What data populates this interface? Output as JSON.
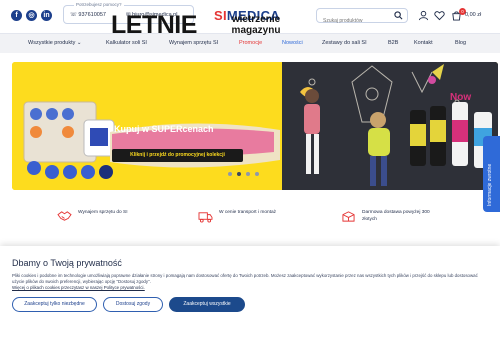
{
  "header": {
    "social_icons": [
      "facebook-icon",
      "instagram-icon",
      "linkedin-icon"
    ],
    "help_label": "Potrzebujesz pomocy?",
    "phone": "937610057",
    "email": "biuro@simedica.pl",
    "logo_prefix": "SI",
    "logo_text": "MEDICA",
    "search_placeholder": "Szukaj produktów",
    "cart_count": "0",
    "cart_total": "0,00 zł"
  },
  "nav": {
    "items": [
      "Wszystkie produkty",
      "Kalkulator soli SI",
      "Wynajem sprzętu SI",
      "Promocje",
      "Nowości",
      "Zestawy do sali SI",
      "B2B",
      "Kontakt",
      "Blog"
    ]
  },
  "banner": {
    "headline": "LETNIE",
    "subheadline": "wietrzenie magazynu",
    "promo": "Kupuj w SUPERcenach",
    "cta": "Kliknij i przejdź do promocyjnej kolekcji",
    "dots_count": 4,
    "active_dot": 1
  },
  "side_tab": {
    "label": "Informacje zwrotne"
  },
  "features": [
    {
      "icon": "handshake-icon",
      "text": "Wynajem sprzętu do SI"
    },
    {
      "icon": "truck-icon",
      "text": "W cenie transport i montaż"
    },
    {
      "icon": "package-icon",
      "text": "Darmowa dostawa powyżej 300 złotych"
    }
  ],
  "cookie": {
    "title": "Dbamy o Twoją prywatność",
    "text": "Pliki cookies i podobne im technologie umożliwiają poprawne działanie strony i pomagają nam dostosować ofertę do Twoich potrzeb. Możesz zaakceptować wykorzystanie przez nas wszystkich tych plików i przejść do sklepu lub dostosować użycie plików do swoich preferencji, wybierając opcję \"Dostosuj zgody\".",
    "more_link": "Więcej o plikach cookies przeczytasz w naszej Polityce prywatności.",
    "btn_necessary": "Zaakceptuj tylko niezbędne",
    "btn_customize": "Dostosuj zgody",
    "btn_accept_all": "Zaakceptuj wszystkie"
  },
  "colors": {
    "brand": "#1c3f8c",
    "accent_red": "#e53535",
    "banner_yellow": "#fddc1e",
    "side_tab": "#2f6ad8"
  }
}
